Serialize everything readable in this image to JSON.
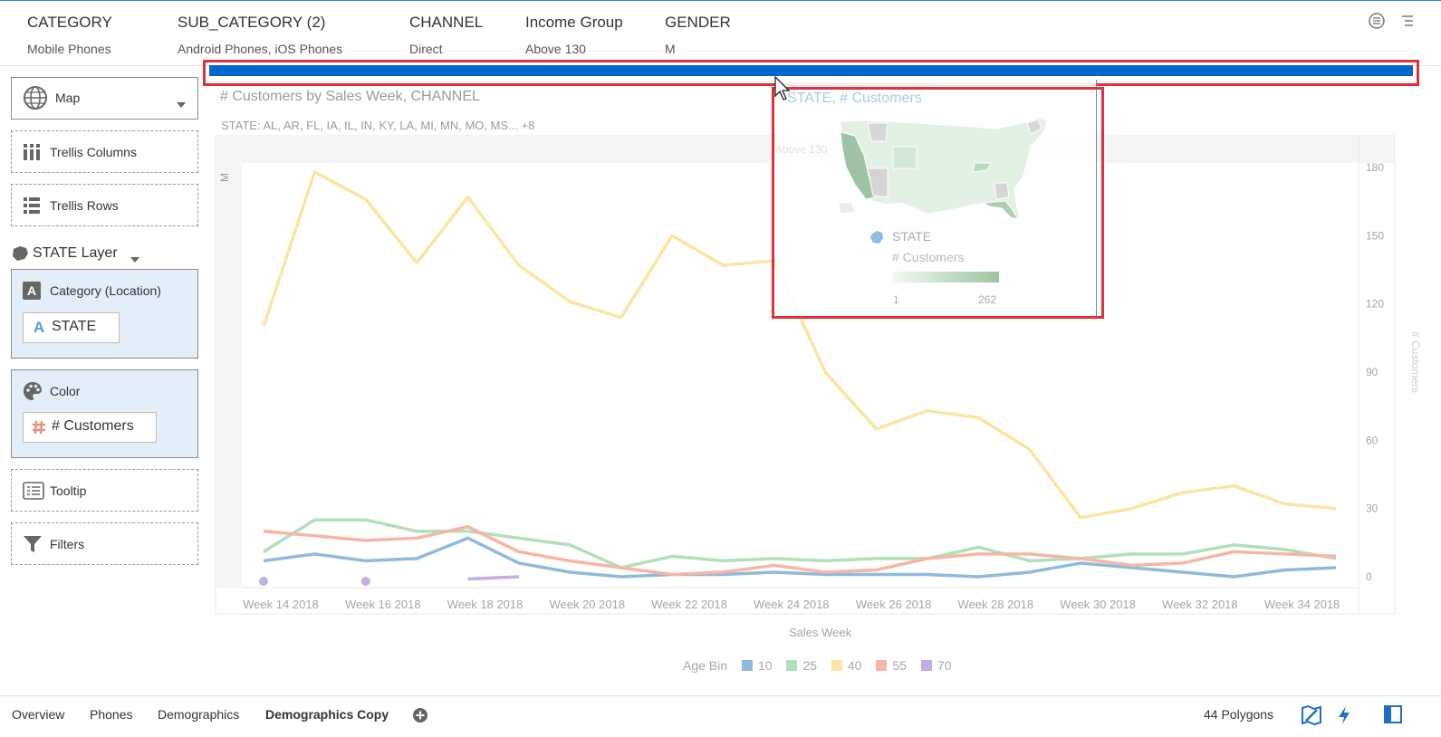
{
  "filters": [
    {
      "header": "CATEGORY",
      "value": "Mobile Phones"
    },
    {
      "header": "SUB_CATEGORY (2)",
      "value": "Android Phones, iOS Phones"
    },
    {
      "header": "CHANNEL",
      "value": "Direct"
    },
    {
      "header": "Income Group",
      "value": "Above 130"
    },
    {
      "header": "GENDER",
      "value": "M"
    }
  ],
  "left_panel": {
    "viz_type": "Map",
    "trellis_columns": "Trellis Columns",
    "trellis_rows": "Trellis Rows",
    "layer": "STATE Layer",
    "category_label": "Category (Location)",
    "category_value": "STATE",
    "color_label": "Color",
    "color_value": "# Customers",
    "tooltip": "Tooltip",
    "filters": "Filters"
  },
  "chart": {
    "title": "# Customers by Sales Week, CHANNEL",
    "subtitle": "STATE: AL, AR, FL, IA, IL, IN, KY, LA, MI, MN, MO, MS... +8",
    "column_header": "Above 130",
    "row_header": "M",
    "legend_title": "Age Bin"
  },
  "chart_data": {
    "type": "line",
    "x": [
      "Week 14 2018",
      "Week 15 2018",
      "Week 16 2018",
      "Week 17 2018",
      "Week 18 2018",
      "Week 19 2018",
      "Week 20 2018",
      "Week 21 2018",
      "Week 22 2018",
      "Week 23 2018",
      "Week 24 2018",
      "Week 25 2018",
      "Week 26 2018",
      "Week 27 2018",
      "Week 28 2018",
      "Week 29 2018",
      "Week 30 2018",
      "Week 31 2018",
      "Week 32 2018",
      "Week 33 2018",
      "Week 34 2018",
      "Week 35 2018"
    ],
    "x_tick_labels": [
      "Week 14 2018",
      "Week 16 2018",
      "Week 18 2018",
      "Week 20 2018",
      "Week 22 2018",
      "Week 24 2018",
      "Week 26 2018",
      "Week 28 2018",
      "Week 30 2018",
      "Week 32 2018",
      "Week 34 2018"
    ],
    "xlabel": "Sales Week",
    "ylabel": "# Customers",
    "ylim": [
      0,
      185
    ],
    "y_ticks": [
      0,
      30,
      60,
      90,
      120,
      150,
      180
    ],
    "y_axis_side": "right",
    "legend_position": "bottom",
    "series": [
      {
        "name": "10",
        "color": "#8fbadb",
        "values": [
          7,
          10,
          7,
          8,
          17,
          6,
          2,
          0,
          1,
          1,
          2,
          1,
          1,
          1,
          0,
          2,
          6,
          4,
          2,
          0,
          3,
          4
        ]
      },
      {
        "name": "25",
        "color": "#b3dfba",
        "values": [
          11,
          25,
          25,
          20,
          20,
          17,
          14,
          4,
          9,
          7,
          8,
          7,
          8,
          8,
          13,
          7,
          8,
          10,
          10,
          14,
          12,
          8
        ]
      },
      {
        "name": "40",
        "color": "#fbe5a1",
        "values": [
          110,
          178,
          166,
          138,
          167,
          137,
          121,
          114,
          150,
          137,
          139,
          90,
          65,
          73,
          70,
          56,
          26,
          30,
          37,
          40,
          32,
          30
        ]
      },
      {
        "name": "55",
        "color": "#f6b5a6",
        "values": [
          20,
          18,
          16,
          17,
          22,
          11,
          7,
          4,
          1,
          2,
          5,
          2,
          3,
          8,
          10,
          10,
          8,
          5,
          6,
          11,
          10,
          9
        ]
      },
      {
        "name": "70",
        "color": "#c3aee0",
        "values": [
          -2,
          null,
          -2,
          null,
          -1,
          0,
          null,
          null,
          null,
          null,
          null,
          null,
          null,
          null,
          null,
          null,
          null,
          null,
          null,
          null,
          null,
          null
        ]
      }
    ]
  },
  "tooltip": {
    "title": "STATE, # Customers",
    "column_header": "Above 130",
    "legend_category": "STATE",
    "legend_measure": "# Customers",
    "range_min": "1",
    "range_max": "262"
  },
  "tabs": [
    "Overview",
    "Phones",
    "Demographics",
    "Demographics Copy"
  ],
  "status": {
    "polygons": "44 Polygons"
  },
  "colors": {
    "accent": "#0066cc",
    "highlight_red": "#e0303a",
    "panel_blue": "#e3eef9"
  },
  "icons": [
    "globe-icon",
    "dropdown-caret-icon",
    "trellis-columns-icon",
    "trellis-rows-icon",
    "state-layer-icon",
    "category-a-icon",
    "palette-icon",
    "hash-icon",
    "tooltip-icon",
    "filter-icon",
    "add-tab-icon",
    "map-tools-icon",
    "lightning-icon",
    "panel-toggle-icon",
    "cursor-icon"
  ]
}
